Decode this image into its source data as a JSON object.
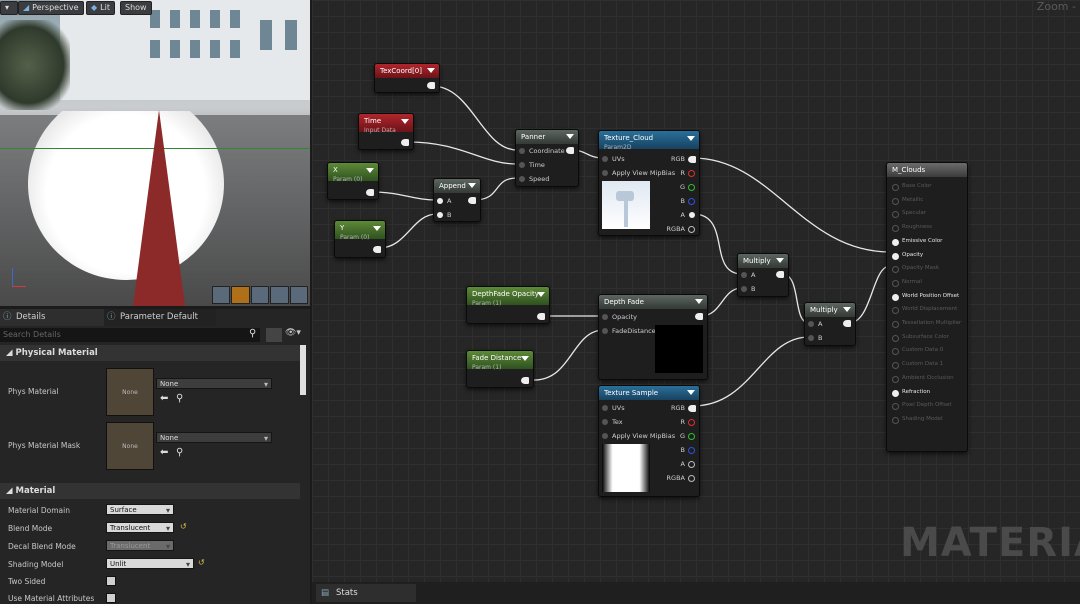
{
  "viewport": {
    "perspective": "Perspective",
    "lit": "Lit",
    "show": "Show"
  },
  "details": {
    "tab_details": "Details",
    "tab_params": "Parameter Default",
    "search_placeholder": "Search Details",
    "physical_material_header": "Physical Material",
    "phys_material_label": "Phys Material",
    "phys_material_thumb": "None",
    "phys_material_value": "None",
    "phys_material_mask_label": "Phys Material Mask",
    "phys_material_mask_thumb": "None",
    "phys_material_mask_value": "None",
    "material_header": "Material",
    "rows": [
      {
        "label": "Material Domain",
        "value": "Surface"
      },
      {
        "label": "Blend Mode",
        "value": "Translucent"
      },
      {
        "label": "Decal Blend Mode",
        "value": "Translucent"
      },
      {
        "label": "Shading Model",
        "value": "Unlit"
      },
      {
        "label": "Two Sided",
        "value": ""
      },
      {
        "label": "Use Material Attributes",
        "value": ""
      }
    ]
  },
  "graph": {
    "zoom_label": "Zoom -",
    "watermark": "MATERIAL",
    "nodes": {
      "texcoord": {
        "title": "TexCoord[0]"
      },
      "time": {
        "title": "Time",
        "sub": "Input Data"
      },
      "x": {
        "title": "X",
        "sub": "Param (0)"
      },
      "y": {
        "title": "Y",
        "sub": "Param (0)"
      },
      "append": {
        "title": "Append",
        "a": "A",
        "b": "B"
      },
      "panner": {
        "title": "Panner",
        "coordinate": "Coordinate",
        "time": "Time",
        "speed": "Speed"
      },
      "texture_cloud": {
        "title": "Texture_Cloud",
        "sub": "Param2D",
        "uvs": "UVs",
        "mip": "Apply View MipBias",
        "rgb": "RGB",
        "r": "R",
        "g": "G",
        "b": "B",
        "a": "A",
        "rgba": "RGBA"
      },
      "multiply1": {
        "title": "Multiply",
        "a": "A",
        "b": "B"
      },
      "depthfade_opacity": {
        "title": "DepthFade Opacity",
        "sub": "Param (1)"
      },
      "depth_fade": {
        "title": "Depth Fade",
        "opacity": "Opacity",
        "fade": "FadeDistance"
      },
      "fade_distance": {
        "title": "Fade Distance",
        "sub": "Param (1)"
      },
      "multiply2": {
        "title": "Multiply",
        "a": "A",
        "b": "B"
      },
      "texture_sample": {
        "title": "Texture Sample",
        "uvs": "UVs",
        "tex": "Tex",
        "mip": "Apply View MipBias",
        "rgb": "RGB",
        "r": "R",
        "g": "G",
        "b": "B",
        "a": "A",
        "rgba": "RGBA"
      },
      "m_clouds": {
        "title": "M_Clouds",
        "pins": [
          {
            "label": "Base Color",
            "active": false
          },
          {
            "label": "Metallic",
            "active": false
          },
          {
            "label": "Specular",
            "active": false
          },
          {
            "label": "Roughness",
            "active": false
          },
          {
            "label": "Emissive Color",
            "active": true
          },
          {
            "label": "Opacity",
            "active": true
          },
          {
            "label": "Opacity Mask",
            "active": false
          },
          {
            "label": "Normal",
            "active": false
          },
          {
            "label": "World Position Offset",
            "active": true
          },
          {
            "label": "World Displacement",
            "active": false
          },
          {
            "label": "Tessellation Multiplier",
            "active": false
          },
          {
            "label": "Subsurface Color",
            "active": false
          },
          {
            "label": "Custom Data 0",
            "active": false
          },
          {
            "label": "Custom Data 1",
            "active": false
          },
          {
            "label": "Ambient Occlusion",
            "active": false
          },
          {
            "label": "Refraction",
            "active": true
          },
          {
            "label": "Pixel Depth Offset",
            "active": false
          },
          {
            "label": "Shading Model",
            "active": false
          }
        ]
      }
    }
  },
  "stats": {
    "tab": "Stats"
  }
}
